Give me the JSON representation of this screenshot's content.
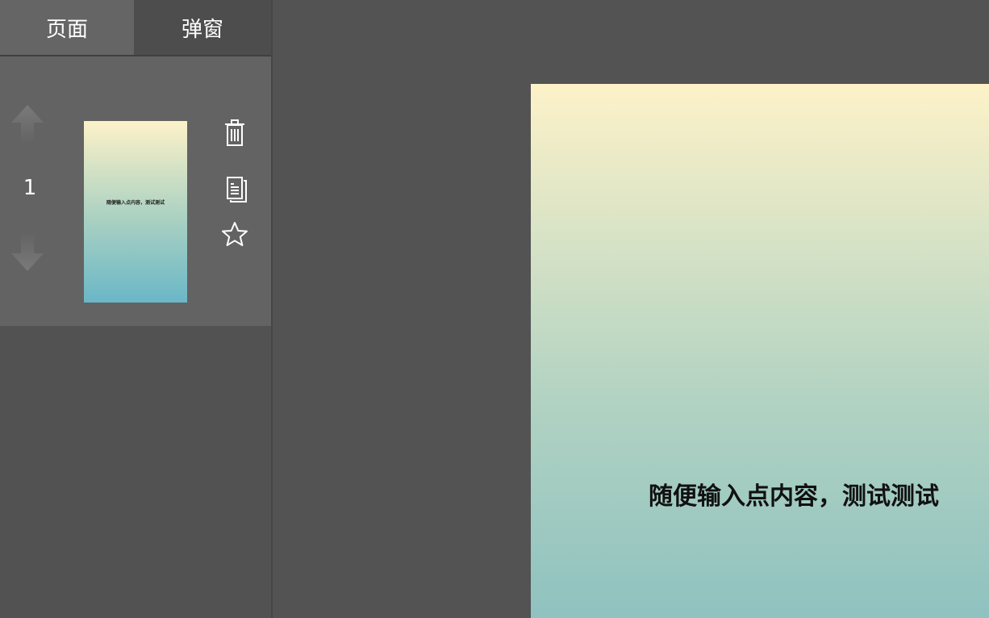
{
  "sidebar": {
    "tabs": [
      {
        "label": "页面",
        "active": true
      },
      {
        "label": "弹窗",
        "active": false
      }
    ],
    "pages": [
      {
        "number": "1",
        "thumbnail_text": "随便输入点内容，测试测试",
        "icons": {
          "move_up": "arrow-up-icon",
          "move_down": "arrow-down-icon",
          "delete": "trash-icon",
          "copy": "copy-icon",
          "favorite": "star-icon"
        }
      }
    ]
  },
  "canvas": {
    "text": "随便输入点内容，测试测试",
    "gradient": [
      "#fdf2c8",
      "#8fc2c0"
    ]
  },
  "colors": {
    "background": "#535353",
    "sidebar": "#525252",
    "tab_active": "#656565",
    "tab_inactive": "#4d4d4d",
    "page_item": "#636363"
  }
}
